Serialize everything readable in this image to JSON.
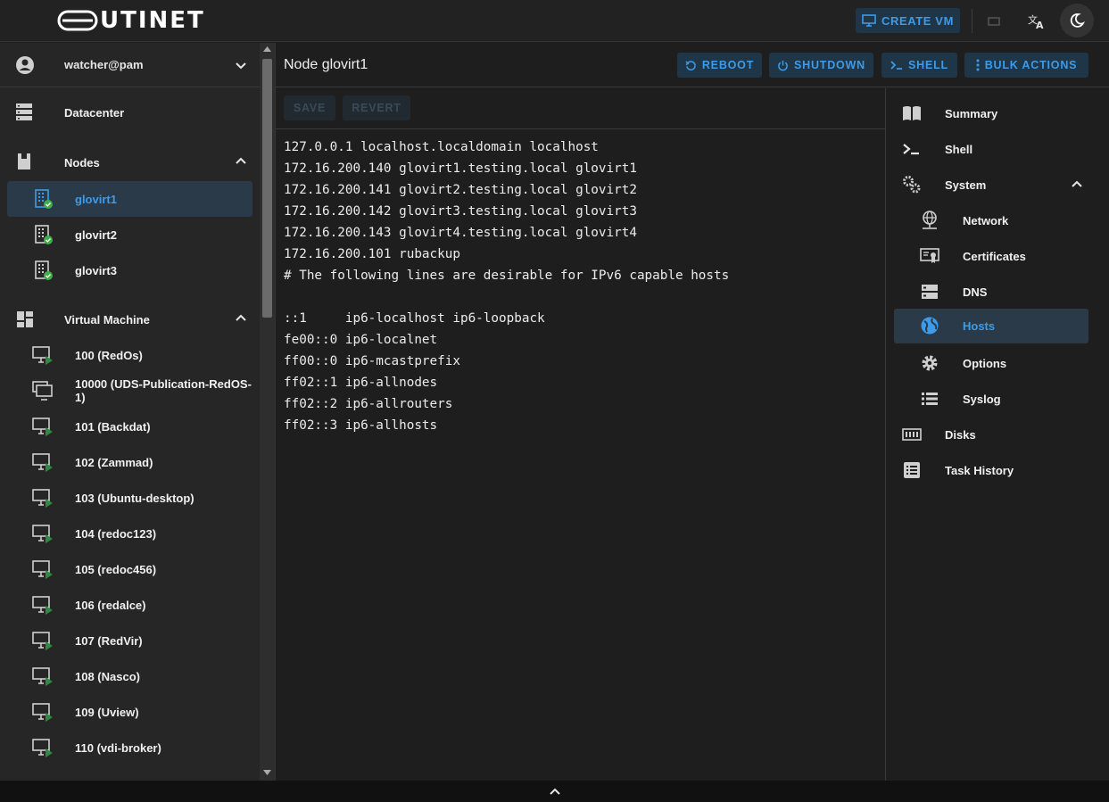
{
  "app": {
    "logo_text": "UTINET",
    "create_vm_label": "CREATE VM"
  },
  "sidebar": {
    "user": "watcher@pam",
    "datacenter_label": "Datacenter",
    "nodes_label": "Nodes",
    "nodes": [
      "glovirt1",
      "glovirt2",
      "glovirt3"
    ],
    "selected_node": "glovirt1",
    "vm_section_label": "Virtual Machine",
    "vms": [
      "100 (RedOs)",
      "10000 (UDS-Publication-RedOS-1)",
      "101 (Backdat)",
      "102 (Zammad)",
      "103 (Ubuntu-desktop)",
      "104 (redoc123)",
      "105 (redoc456)",
      "106 (redalce)",
      "107 (RedVir)",
      "108 (Nasco)",
      "109 (Uview)",
      "110 (vdi-broker)"
    ]
  },
  "main": {
    "title": "Node glovirt1",
    "actions": {
      "reboot": "REBOOT",
      "shutdown": "SHUTDOWN",
      "shell": "SHELL",
      "bulk": "BULK ACTIONS"
    },
    "toolbar": {
      "save": "SAVE",
      "revert": "REVERT"
    },
    "hosts_file": [
      "127.0.0.1 localhost.localdomain localhost",
      "172.16.200.140 glovirt1.testing.local glovirt1",
      "172.16.200.141 glovirt2.testing.local glovirt2",
      "172.16.200.142 glovirt3.testing.local glovirt3",
      "172.16.200.143 glovirt4.testing.local glovirt4",
      "172.16.200.101 rubackup",
      "# The following lines are desirable for IPv6 capable hosts",
      "",
      "::1     ip6-localhost ip6-loopback",
      "fe00::0 ip6-localnet",
      "ff00::0 ip6-mcastprefix",
      "ff02::1 ip6-allnodes",
      "ff02::2 ip6-allrouters",
      "ff02::3 ip6-allhosts"
    ]
  },
  "right_nav": {
    "summary": "Summary",
    "shell": "Shell",
    "system": "System",
    "network": "Network",
    "certificates": "Certificates",
    "dns": "DNS",
    "hosts": "Hosts",
    "options": "Options",
    "syslog": "Syslog",
    "disks": "Disks",
    "task_history": "Task History"
  },
  "colors": {
    "accent": "#3d9be9",
    "status_ok": "#3fae49",
    "vm_running": "#2e8b3a"
  }
}
